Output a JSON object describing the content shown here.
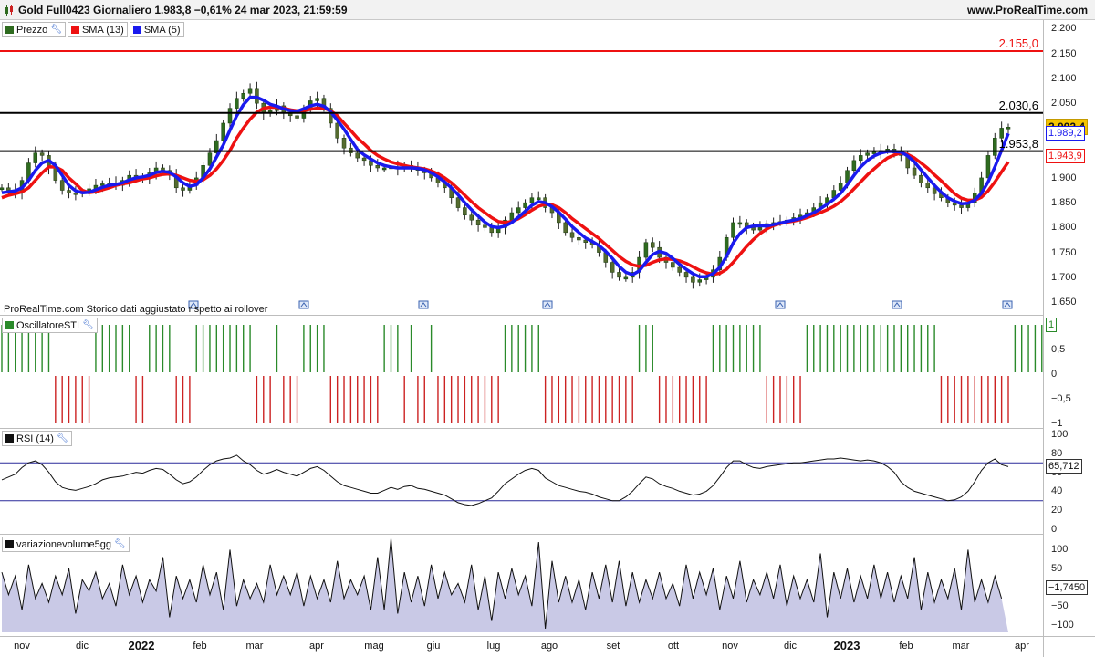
{
  "header": {
    "title": "Gold Full0423 Giornaliero 1.983,8 −0,61% 24 mar 2023, 21:59:59",
    "site": "www.ProRealTime.com",
    "chart_icon": "candlestick-icon"
  },
  "colors": {
    "up_bar": "#2e6b1f",
    "down_bar": "#556b2f",
    "sma13": "#ee1111",
    "sma5": "#1a1aee",
    "resistance": "#ee1111",
    "level": "#000000",
    "sti_up": "#2a8a2a",
    "sti_down": "#cc2222",
    "rsi_line": "#111111",
    "rsi_band": "#2a2a9a",
    "vol_fill": "#c9c9e6",
    "last_price_bg": "#f5c400"
  },
  "price_panel": {
    "legend": [
      {
        "label": "Prezzo",
        "swatch": "#2e6b1f"
      },
      {
        "label": "SMA (13)",
        "swatch": "#ee1111"
      },
      {
        "label": "SMA (5)",
        "swatch": "#1a1aee"
      }
    ],
    "note": "ProRealTime.com  Storico dati aggiustato rispetto ai rollover",
    "y_ticks": [
      "2.200",
      "2.150",
      "2.100",
      "2.050",
      "2.000",
      "1.950",
      "1.900",
      "1.850",
      "1.800",
      "1.750",
      "1.700",
      "1.650"
    ],
    "y_tick_values": [
      2200,
      2150,
      2100,
      2050,
      2000,
      1950,
      1900,
      1850,
      1800,
      1750,
      1700,
      1650
    ],
    "levels": [
      {
        "value": 2155.0,
        "label": "2.155,0",
        "type": "resistance"
      },
      {
        "value": 2030.6,
        "label": "2.030,6",
        "type": "level"
      },
      {
        "value": 1953.8,
        "label": "1.953,8",
        "type": "level"
      }
    ],
    "tags": [
      {
        "value": 2002.4,
        "label": "2.002,4",
        "kind": "last"
      },
      {
        "value": 1989.2,
        "label": "1.989,2",
        "kind": "sma5"
      },
      {
        "value": 1943.9,
        "label": "1.943,9",
        "kind": "sma13"
      }
    ],
    "rollover_icon": "rollover-marker-icon"
  },
  "sti_panel": {
    "legend": {
      "label": "OscillatoreSTI",
      "swatch": "#2a8a2a"
    },
    "y_ticks": [
      "0,5",
      "0",
      "−0,5",
      "−1"
    ],
    "y_tick_values": [
      0.5,
      0,
      -0.5,
      -1
    ],
    "current": "1"
  },
  "rsi_panel": {
    "legend": {
      "label": "RSI (14)",
      "swatch": "#111111"
    },
    "y_ticks": [
      "100",
      "80",
      "60",
      "40",
      "20",
      "0"
    ],
    "y_tick_values": [
      100,
      80,
      60,
      40,
      20,
      0
    ],
    "bands": [
      70,
      30
    ],
    "current": "65,712"
  },
  "vol_panel": {
    "legend": {
      "label": "variazionevolume5gg",
      "swatch": "#111111"
    },
    "y_ticks": [
      "100",
      "50",
      "0",
      "−50",
      "−100"
    ],
    "y_tick_values": [
      100,
      50,
      0,
      -50,
      -100
    ],
    "current": "−1,7450"
  },
  "x_axis": [
    {
      "label": "nov",
      "bold": false
    },
    {
      "label": "dic",
      "bold": false
    },
    {
      "label": "2022",
      "bold": true
    },
    {
      "label": "feb",
      "bold": false
    },
    {
      "label": "mar",
      "bold": false
    },
    {
      "label": "apr",
      "bold": false
    },
    {
      "label": "mag",
      "bold": false
    },
    {
      "label": "giu",
      "bold": false
    },
    {
      "label": "lug",
      "bold": false
    },
    {
      "label": "ago",
      "bold": false
    },
    {
      "label": "set",
      "bold": false
    },
    {
      "label": "ott",
      "bold": false
    },
    {
      "label": "nov",
      "bold": false
    },
    {
      "label": "dic",
      "bold": false
    },
    {
      "label": "2023",
      "bold": true
    },
    {
      "label": "feb",
      "bold": false
    },
    {
      "label": "mar",
      "bold": false
    },
    {
      "label": "apr",
      "bold": false
    }
  ],
  "chart_data": {
    "type": "line",
    "series": [
      {
        "name": "Prezzo",
        "values": [
          1880,
          1875,
          1870,
          1895,
          1930,
          1950,
          1945,
          1920,
          1895,
          1875,
          1870,
          1868,
          1872,
          1878,
          1885,
          1888,
          1890,
          1885,
          1895,
          1905,
          1902,
          1898,
          1910,
          1920,
          1915,
          1905,
          1880,
          1875,
          1885,
          1900,
          1925,
          1950,
          1975,
          2010,
          2040,
          2060,
          2070,
          2080,
          2050,
          2030,
          2035,
          2045,
          2030,
          2025,
          2020,
          2040,
          2055,
          2060,
          2040,
          2010,
          1980,
          1960,
          1950,
          1940,
          1935,
          1925,
          1920,
          1920,
          1922,
          1918,
          1925,
          1920,
          1915,
          1910,
          1900,
          1890,
          1880,
          1860,
          1840,
          1825,
          1815,
          1805,
          1800,
          1790,
          1800,
          1815,
          1830,
          1840,
          1850,
          1860,
          1860,
          1840,
          1830,
          1810,
          1790,
          1780,
          1775,
          1770,
          1765,
          1750,
          1730,
          1710,
          1700,
          1700,
          1710,
          1740,
          1770,
          1760,
          1740,
          1730,
          1720,
          1710,
          1700,
          1690,
          1695,
          1700,
          1715,
          1740,
          1780,
          1810,
          1810,
          1800,
          1795,
          1800,
          1808,
          1810,
          1812,
          1815,
          1820,
          1825,
          1830,
          1840,
          1850,
          1860,
          1875,
          1890,
          1915,
          1935,
          1945,
          1950,
          1952,
          1955,
          1958,
          1950,
          1945,
          1920,
          1905,
          1890,
          1880,
          1868,
          1860,
          1850,
          1845,
          1840,
          1850,
          1870,
          1900,
          1945,
          1980,
          2000,
          2002
        ]
      },
      {
        "name": "SMA (13)",
        "values": [
          1860,
          1865,
          1868,
          1872,
          1880,
          1895,
          1910,
          1922,
          1922,
          1915,
          1900,
          1888,
          1875,
          1870,
          1872,
          1876,
          1880,
          1885,
          1888,
          1890,
          1894,
          1898,
          1900,
          1904,
          1907,
          1908,
          1905,
          1900,
          1895,
          1893,
          1896,
          1905,
          1918,
          1935,
          1955,
          1980,
          2000,
          2018,
          2032,
          2040,
          2042,
          2042,
          2040,
          2037,
          2035,
          2035,
          2038,
          2040,
          2040,
          2035,
          2025,
          2010,
          1995,
          1980,
          1968,
          1955,
          1945,
          1938,
          1932,
          1928,
          1925,
          1922,
          1920,
          1918,
          1914,
          1908,
          1900,
          1890,
          1878,
          1865,
          1852,
          1840,
          1830,
          1820,
          1812,
          1810,
          1812,
          1818,
          1826,
          1835,
          1843,
          1847,
          1846,
          1840,
          1830,
          1818,
          1808,
          1798,
          1788,
          1778,
          1766,
          1754,
          1742,
          1732,
          1725,
          1722,
          1724,
          1730,
          1735,
          1737,
          1736,
          1733,
          1728,
          1721,
          1714,
          1709,
          1706,
          1708,
          1716,
          1730,
          1746,
          1762,
          1776,
          1788,
          1797,
          1804,
          1808,
          1811,
          1813,
          1816,
          1820,
          1825,
          1830,
          1836,
          1843,
          1852,
          1864,
          1878,
          1892,
          1906,
          1918,
          1930,
          1940,
          1946,
          1950,
          1947,
          1940,
          1930,
          1919,
          1906,
          1894,
          1881,
          1868,
          1859,
          1855,
          1855,
          1861,
          1874,
          1892,
          1912,
          1932
        ]
      },
      {
        "name": "SMA (5)",
        "values": [
          1870,
          1872,
          1874,
          1880,
          1895,
          1915,
          1930,
          1935,
          1925,
          1905,
          1885,
          1874,
          1870,
          1871,
          1876,
          1881,
          1885,
          1887,
          1890,
          1896,
          1900,
          1902,
          1905,
          1911,
          1913,
          1911,
          1902,
          1890,
          1883,
          1886,
          1900,
          1918,
          1942,
          1966,
          1996,
          2025,
          2047,
          2062,
          2062,
          2056,
          2048,
          2044,
          2039,
          2035,
          2034,
          2039,
          2045,
          2048,
          2044,
          2033,
          2016,
          1998,
          1977,
          1957,
          1946,
          1938,
          1930,
          1925,
          1922,
          1920,
          1920,
          1920,
          1919,
          1916,
          1910,
          1902,
          1892,
          1880,
          1866,
          1850,
          1836,
          1823,
          1811,
          1802,
          1800,
          1803,
          1810,
          1821,
          1833,
          1845,
          1852,
          1850,
          1842,
          1831,
          1817,
          1802,
          1790,
          1779,
          1772,
          1764,
          1752,
          1738,
          1722,
          1710,
          1705,
          1713,
          1730,
          1746,
          1752,
          1748,
          1738,
          1726,
          1716,
          1707,
          1701,
          1701,
          1707,
          1720,
          1742,
          1769,
          1788,
          1800,
          1803,
          1804,
          1803,
          1806,
          1809,
          1812,
          1815,
          1818,
          1824,
          1830,
          1838,
          1847,
          1857,
          1869,
          1886,
          1905,
          1922,
          1935,
          1944,
          1950,
          1953,
          1953,
          1952,
          1944,
          1932,
          1916,
          1900,
          1885,
          1871,
          1860,
          1853,
          1848,
          1849,
          1855,
          1869,
          1892,
          1922,
          1955,
          1989
        ]
      }
    ],
    "rsi": [
      52,
      55,
      58,
      65,
      70,
      72,
      68,
      60,
      50,
      44,
      42,
      41,
      43,
      45,
      48,
      52,
      54,
      55,
      56,
      58,
      60,
      59,
      62,
      64,
      63,
      58,
      52,
      48,
      50,
      55,
      62,
      68,
      72,
      74,
      75,
      78,
      72,
      68,
      62,
      58,
      60,
      63,
      60,
      58,
      56,
      60,
      64,
      66,
      62,
      56,
      50,
      46,
      44,
      42,
      40,
      38,
      38,
      41,
      44,
      42,
      45,
      46,
      43,
      42,
      40,
      38,
      36,
      32,
      28,
      26,
      25,
      27,
      30,
      33,
      40,
      48,
      53,
      58,
      62,
      64,
      62,
      54,
      50,
      46,
      44,
      42,
      40,
      39,
      37,
      34,
      32,
      30,
      30,
      34,
      40,
      48,
      55,
      53,
      48,
      45,
      43,
      40,
      38,
      36,
      37,
      40,
      46,
      55,
      65,
      72,
      72,
      68,
      65,
      64,
      66,
      67,
      68,
      69,
      70,
      70,
      71,
      72,
      73,
      74,
      74,
      75,
      74,
      73,
      72,
      73,
      72,
      70,
      66,
      60,
      50,
      44,
      40,
      38,
      36,
      34,
      32,
      30,
      31,
      34,
      40,
      50,
      62,
      70,
      74,
      68,
      66
    ],
    "sti": [
      1,
      1,
      1,
      1,
      1,
      1,
      1,
      1,
      -1,
      -1,
      -1,
      -1,
      -1,
      -1,
      1,
      1,
      1,
      1,
      1,
      1,
      -1,
      -1,
      1,
      1,
      1,
      1,
      -1,
      -1,
      -1,
      1,
      1,
      1,
      1,
      1,
      1,
      1,
      1,
      1,
      -1,
      -1,
      -1,
      1,
      -1,
      -1,
      -1,
      1,
      1,
      1,
      1,
      -1,
      -1,
      -1,
      -1,
      -1,
      -1,
      -1,
      -1,
      1,
      1,
      1,
      -1,
      1,
      -1,
      -1,
      1,
      -1,
      -1,
      -1,
      -1,
      -1,
      -1,
      -1,
      -1,
      -1,
      -1,
      1,
      1,
      1,
      1,
      1,
      1,
      -1,
      -1,
      -1,
      -1,
      -1,
      -1,
      -1,
      -1,
      -1,
      -1,
      -1,
      -1,
      -1,
      -1,
      1,
      1,
      1,
      -1,
      -1,
      -1,
      -1,
      -1,
      -1,
      -1,
      -1,
      1,
      1,
      1,
      1,
      1,
      1,
      1,
      1,
      -1,
      -1,
      -1,
      -1,
      -1,
      -1,
      1,
      1,
      1,
      1,
      1,
      1,
      1,
      1,
      1,
      1,
      1,
      1,
      1,
      1,
      1,
      1,
      1,
      1,
      1,
      1,
      -1,
      -1,
      -1,
      -1,
      -1,
      -1,
      -1,
      -1,
      -1,
      -1,
      -1,
      1,
      1,
      1,
      1,
      1,
      1,
      1
    ],
    "volume_change": [
      40,
      -20,
      30,
      -60,
      60,
      -30,
      10,
      -40,
      30,
      -20,
      50,
      -70,
      20,
      -10,
      40,
      -30,
      10,
      -50,
      60,
      -20,
      30,
      -40,
      20,
      -10,
      80,
      -80,
      30,
      -30,
      20,
      -40,
      60,
      -20,
      40,
      -60,
      100,
      -50,
      20,
      -30,
      10,
      -40,
      60,
      -20,
      30,
      -20,
      40,
      -50,
      30,
      -30,
      20,
      -40,
      70,
      -30,
      20,
      -20,
      30,
      -60,
      80,
      -60,
      130,
      -70,
      40,
      -40,
      30,
      -50,
      60,
      -30,
      40,
      -20,
      10,
      -40,
      60,
      -60,
      30,
      -90,
      40,
      -30,
      50,
      -20,
      30,
      -50,
      120,
      -110,
      70,
      -40,
      30,
      -40,
      20,
      -60,
      40,
      -30,
      60,
      -40,
      70,
      -50,
      40,
      -40,
      20,
      -30,
      40,
      -30,
      10,
      -50,
      60,
      -30,
      40,
      -20,
      50,
      -60,
      30,
      -30,
      70,
      -40,
      20,
      -20,
      40,
      -30,
      60,
      -50,
      30,
      -30,
      20,
      -40,
      90,
      -80,
      40,
      -30,
      50,
      -40,
      30,
      -30,
      60,
      -30,
      40,
      -40,
      30,
      -30,
      80,
      -60,
      40,
      -40,
      20,
      -30,
      50,
      -60,
      100,
      -40,
      20,
      -40,
      30,
      -30
    ],
    "ylim": [
      1630,
      2210
    ],
    "rsi_ylim": [
      0,
      100
    ],
    "sti_ylim": [
      -1,
      1
    ],
    "vol_ylim": [
      -120,
      130
    ]
  }
}
